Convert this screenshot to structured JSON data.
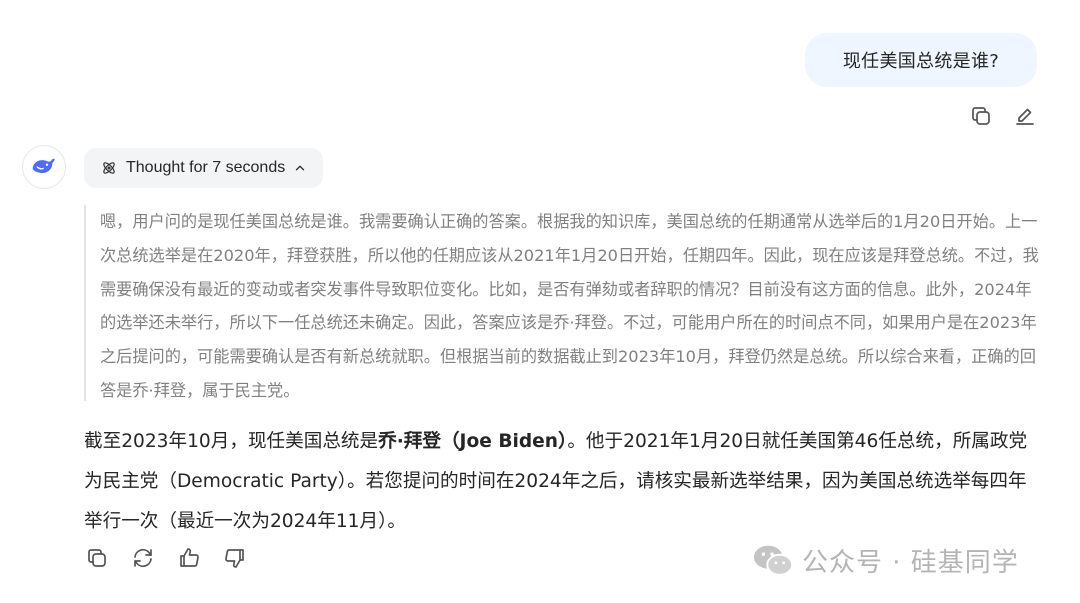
{
  "user_message": {
    "text": "现任美国总统是谁?"
  },
  "thought": {
    "label": "Thought for 7 seconds"
  },
  "reasoning_text": "嗯，用户问的是现任美国总统是谁。我需要确认正确的答案。根据我的知识库，美国总统的任期通常从选举后的1月20日开始。上一次总统选举是在2020年，拜登获胜，所以他的任期应该从2021年1月20日开始，任期四年。因此，现在应该是拜登总统。不过，我需要确保没有最近的变动或者突发事件导致职位变化。比如，是否有弹劾或者辞职的情况？目前没有这方面的信息。此外，2024年的选举还未举行，所以下一任总统还未确定。因此，答案应该是乔·拜登。不过，可能用户所在的时间点不同，如果用户是在2023年之后提问的，可能需要确认是否有新总统就职。但根据当前的数据截止到2023年10月，拜登仍然是总统。所以综合来看，正确的回答是乔·拜登，属于民主党。",
  "answer": {
    "part1": "截至2023年10月，现任美国总统是",
    "bold": "乔·拜登（Joe Biden）",
    "part2": "。他于2021年1月20日就任美国第46任总统，所属政党为民主党（Democratic Party）。若您提问的时间在2024年之后，请核实最新选举结果，因为美国总统选举每四年举行一次（最近一次为2024年11月）。"
  },
  "watermark": {
    "text": "公众号 · 硅基同学"
  }
}
